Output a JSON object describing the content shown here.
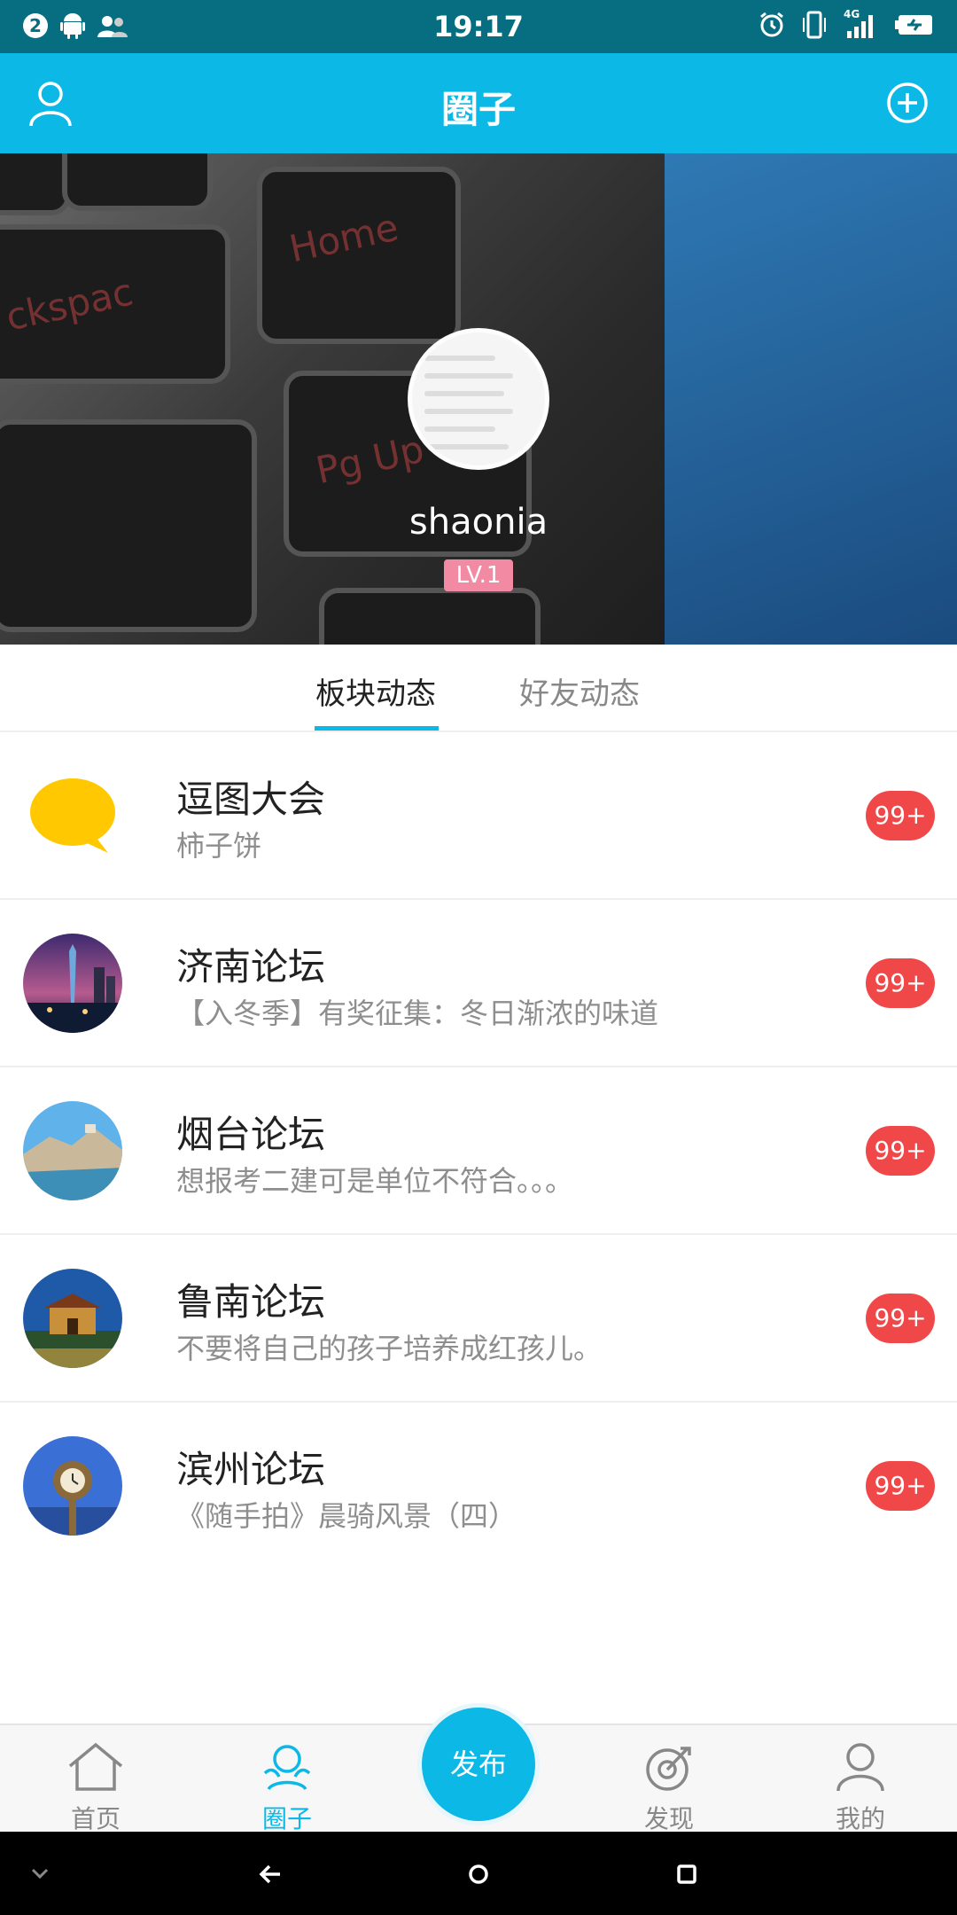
{
  "status_bar": {
    "notification_count": "2",
    "time": "19:17",
    "network": "4G",
    "icons": [
      "notification-badge-icon",
      "android-icon",
      "contacts-icon",
      "alarm-icon",
      "vibrate-icon",
      "signal-icon",
      "battery-icon"
    ]
  },
  "app_bar": {
    "title": "圈子",
    "left_icon": "person-icon",
    "right_icon": "add-circle-icon"
  },
  "profile": {
    "username": "shaonia",
    "level": "LV.1",
    "keyboard_labels": [
      "Home",
      "Pg Up",
      "ckspac"
    ]
  },
  "tabs": [
    {
      "label": "板块动态",
      "active": true
    },
    {
      "label": "好友动态",
      "active": false
    }
  ],
  "forums": [
    {
      "title": "逗图大会",
      "subtitle": "柿子饼",
      "badge": "99+",
      "icon": "speech-bubble-icon"
    },
    {
      "title": "济南论坛",
      "subtitle": "【入冬季】有奖征集：冬日渐浓的味道",
      "badge": "99+",
      "icon": "jinan-city-icon"
    },
    {
      "title": "烟台论坛",
      "subtitle": "想报考二建可是单位不符合。。。",
      "badge": "99+",
      "icon": "yantai-coast-icon"
    },
    {
      "title": "鲁南论坛",
      "subtitle": "不要将自己的孩子培养成红孩儿。",
      "badge": "99+",
      "icon": "lunan-gate-icon"
    },
    {
      "title": "滨州论坛",
      "subtitle": "《随手拍》晨骑风景（四）",
      "badge": "99+",
      "icon": "binzhou-clock-icon"
    }
  ],
  "bottom_nav": {
    "items": [
      {
        "label": "首页",
        "icon": "home-icon",
        "active": false
      },
      {
        "label": "圈子",
        "icon": "circle-people-icon",
        "active": true
      },
      {
        "label": "发现",
        "icon": "target-icon",
        "active": false
      },
      {
        "label": "我的",
        "icon": "profile-icon",
        "active": false
      }
    ],
    "publish_label": "发布"
  },
  "colors": {
    "primary": "#0bb8e6",
    "status_bar": "#066e80",
    "badge": "#f04848",
    "level_badge": "#f38aa4"
  }
}
